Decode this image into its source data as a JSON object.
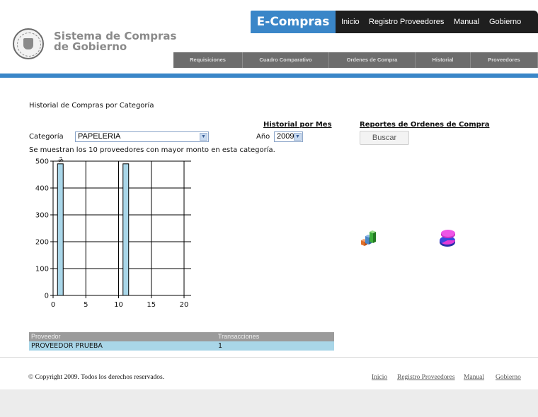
{
  "header": {
    "logo_line1": "Sistema de Compras",
    "logo_line2": "de Gobierno",
    "brand": "E-Compras",
    "topnav": [
      "Inicio",
      "Registro Proveedores",
      "Manual",
      "Gobierno"
    ],
    "tabs": [
      "Requisiciones",
      "Cuadro Comparativo",
      "Ordenes de Compra",
      "Historial",
      "Proveedores"
    ]
  },
  "main": {
    "page_title": "Historial de Compras por Categoría",
    "historial_mes_link": "Historial por Mes",
    "reportes_link": "Reportes de Ordenes de Compra",
    "categoria_label": "Categoría",
    "categoria_value": "PAPELERIA",
    "anio_label": "Año",
    "anio_value": "2009",
    "buscar_label": "Buscar",
    "info_text": "Se muestran los 10 proveedores con mayor monto en esta categoría.",
    "icons": [
      "bar-chart-3d-icon",
      "pie-chart-3d-icon"
    ]
  },
  "chart_data": {
    "type": "bar",
    "x": [
      1,
      11
    ],
    "values": [
      490,
      490
    ],
    "data_labels": [
      "$49",
      ""
    ],
    "xlim": [
      0,
      20
    ],
    "ylim": [
      0,
      500
    ],
    "xticks": [
      "0",
      "5",
      "10",
      "15",
      "20"
    ],
    "yticks": [
      "0",
      "100",
      "200",
      "300",
      "400",
      "500"
    ],
    "bar_color": "#a9d6e8",
    "grid": true
  },
  "table": {
    "headers": [
      "Proveedor",
      "Transacciones"
    ],
    "rows": [
      [
        "PROVEEDOR PRUEBA",
        "1"
      ]
    ]
  },
  "footer": {
    "copyright": "© Copyright 2009. Todos los derechos reservados.",
    "links": [
      "Inicio",
      "Registro Proveedores",
      "Manual",
      "Gobierno"
    ]
  },
  "colors": {
    "accent_blue": "#3a86c8",
    "nav_dark": "#1f1f1f",
    "tab_gray": "#6d6d6d",
    "row_blue": "#a9d6e8"
  }
}
